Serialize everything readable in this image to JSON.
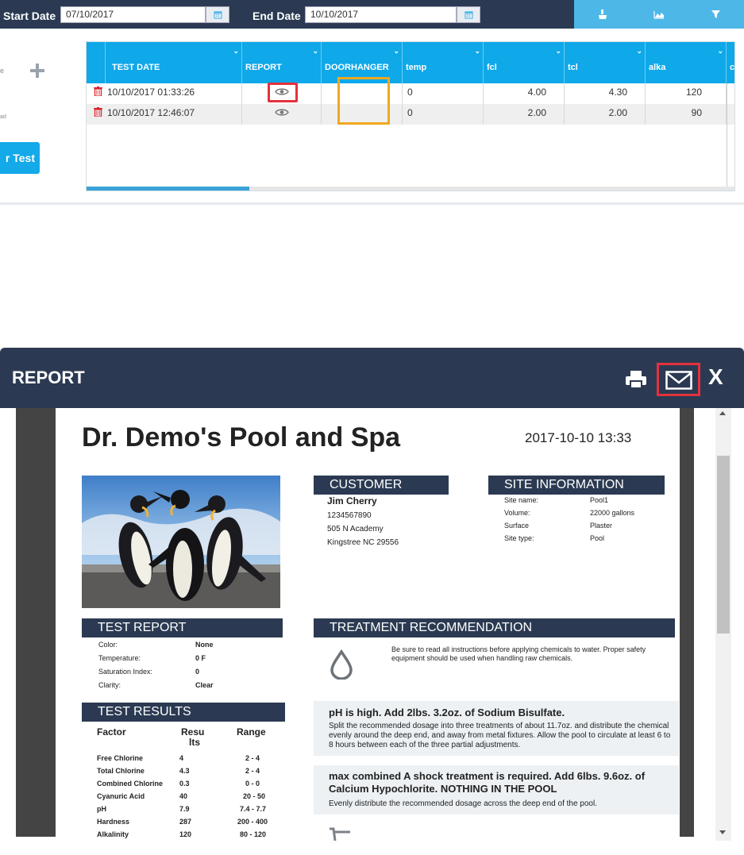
{
  "filters": {
    "start_label": "Start Date",
    "start_value": "07/10/2017",
    "end_label": "End Date",
    "end_value": "10/10/2017"
  },
  "toolbar": {
    "icons": [
      "broom-icon",
      "area-chart-icon",
      "filter-icon"
    ]
  },
  "left_panel": {
    "new_test_label": "r Test",
    "snippet_1": "e",
    "snippet_2": "ad"
  },
  "table": {
    "columns": [
      "",
      "TEST DATE",
      "REPORT",
      "DOORHANGER",
      "temp",
      "fcl",
      "tcl",
      "alka",
      "c"
    ],
    "rows": [
      {
        "date": "10/10/2017 01:33:26",
        "temp": "0",
        "fcl": "4.00",
        "tcl": "4.30",
        "alka": "120"
      },
      {
        "date": "10/10/2017 12:46:07",
        "temp": "0",
        "fcl": "2.00",
        "tcl": "2.00",
        "alka": "90"
      }
    ],
    "scroll_fraction": 0.25
  },
  "modal": {
    "title": "REPORT",
    "close_label": "X",
    "business_name": "Dr. Demo's Pool and Spa",
    "report_datetime": "2017-10-10 13:33",
    "customer": {
      "heading": "CUSTOMER",
      "name": "Jim Cherry",
      "phone": "1234567890",
      "street": "505 N Academy",
      "city": "Kingstree NC 29556"
    },
    "site": {
      "heading": "SITE INFORMATION",
      "items": [
        {
          "label": "Site name:",
          "value": "Pool1"
        },
        {
          "label": "Volume:",
          "value": "22000 gallons"
        },
        {
          "label": "Surface",
          "value": "Plaster"
        },
        {
          "label": "Site type:",
          "value": "Pool"
        }
      ]
    },
    "test_report": {
      "heading": "TEST REPORT",
      "items": [
        {
          "label": "Color:",
          "value": "None"
        },
        {
          "label": "Temperature:",
          "value": "0 F"
        },
        {
          "label": "Saturation Index:",
          "value": "0"
        },
        {
          "label": "Clarity:",
          "value": "Clear"
        }
      ]
    },
    "test_results": {
      "heading": "TEST RESULTS",
      "col_factor": "Factor",
      "col_results_1": "Resu",
      "col_results_2": "lts",
      "col_range": "Range",
      "rows": [
        {
          "factor": "Free Chlorine",
          "result": "4",
          "range": "2 - 4"
        },
        {
          "factor": "Total Chlorine",
          "result": "4.3",
          "range": "2 - 4"
        },
        {
          "factor": "Combined Chlorine",
          "result": "0.3",
          "range": "0 - 0"
        },
        {
          "factor": "Cyanuric Acid",
          "result": "40",
          "range": "20 - 50"
        },
        {
          "factor": "pH",
          "result": "7.9",
          "range": "7.4 - 7.7"
        },
        {
          "factor": "Hardness",
          "result": "287",
          "range": "200 - 400"
        },
        {
          "factor": "Alkalinity",
          "result": "120",
          "range": "80 - 120"
        }
      ]
    },
    "treatment": {
      "heading": "TREATMENT RECOMMENDATION",
      "intro": "Be sure to read all instructions before applying chemicals to water. Proper safety equipment should be used when handling raw chemicals.",
      "rec1_title": "pH is high. Add 2lbs. 3.2oz. of Sodium Bisulfate.",
      "rec1_body": "Split the recommended dosage into three treatments of about 11.7oz. and distribute the chemical evenly around the deep end, and away from metal fixtures.  Allow the pool to circulate at least 6 to 8 hours between each of the three partial adjustments.",
      "rec2_title_1": "max combined A shock treatment is required. Add 6lbs. 9.6oz. of",
      "rec2_title_2": "Calcium Hypochlorite. NOTHING IN THE POOL",
      "rec2_body": "Evenly distribute the recommended dosage across the deep end of the pool."
    }
  }
}
